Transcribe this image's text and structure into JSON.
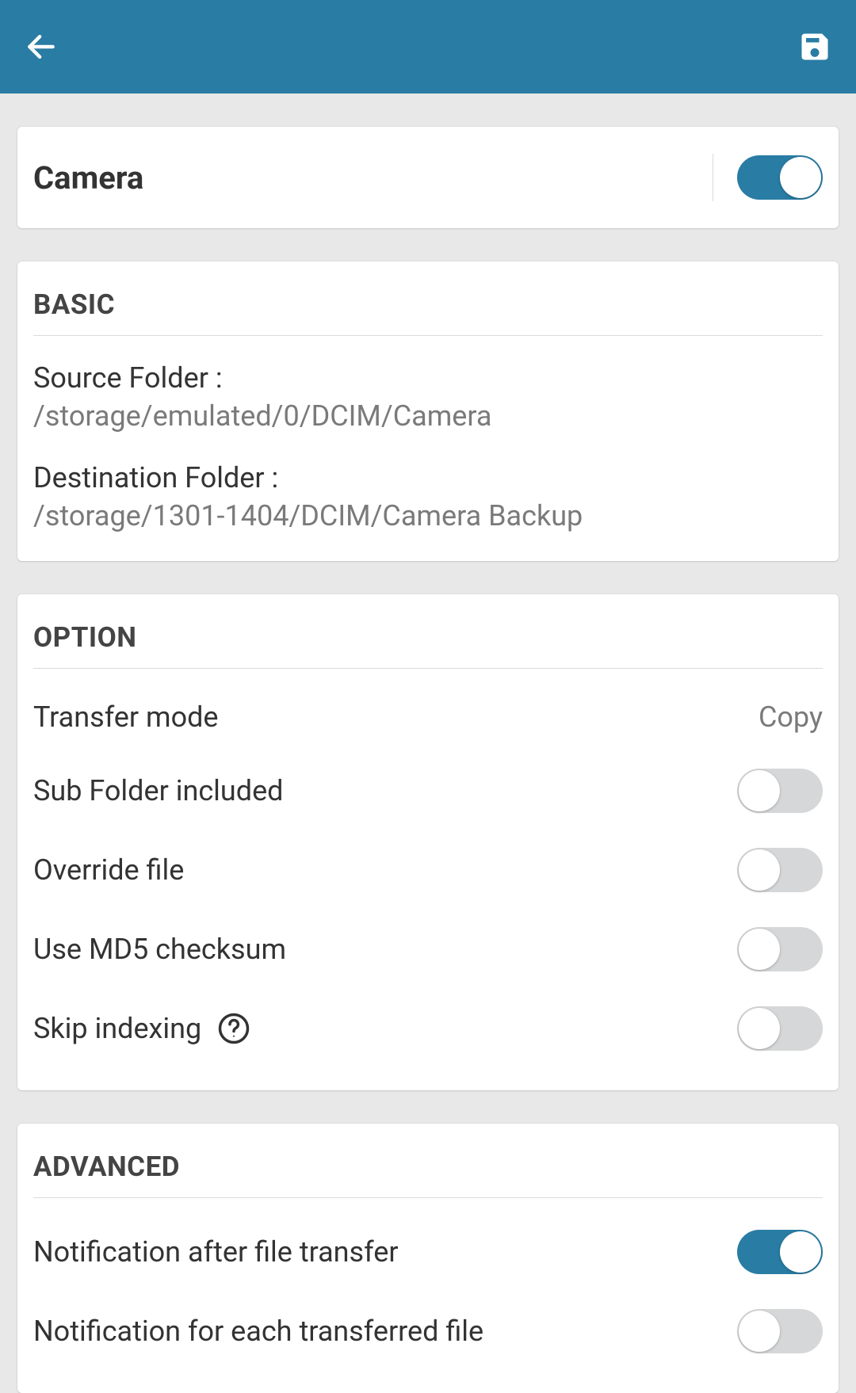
{
  "colors": {
    "primary": "#297ca3"
  },
  "title": {
    "label": "Camera",
    "enabled": true
  },
  "basic": {
    "header": "BASIC",
    "source_label": "Source Folder :",
    "source_value": "/storage/emulated/0/DCIM/Camera",
    "dest_label": "Destination Folder :",
    "dest_value": "/storage/1301-1404/DCIM/Camera Backup"
  },
  "option": {
    "header": "OPTION",
    "transfer_mode_label": "Transfer mode",
    "transfer_mode_value": "Copy",
    "subfolder_label": "Sub Folder included",
    "subfolder_on": false,
    "override_label": "Override file",
    "override_on": false,
    "md5_label": "Use MD5 checksum",
    "md5_on": false,
    "skip_indexing_label": "Skip indexing",
    "skip_indexing_on": false
  },
  "advanced": {
    "header": "ADVANCED",
    "notify_after_label": "Notification after file transfer",
    "notify_after_on": true,
    "notify_each_label": "Notification for each transferred file",
    "notify_each_on": false
  }
}
